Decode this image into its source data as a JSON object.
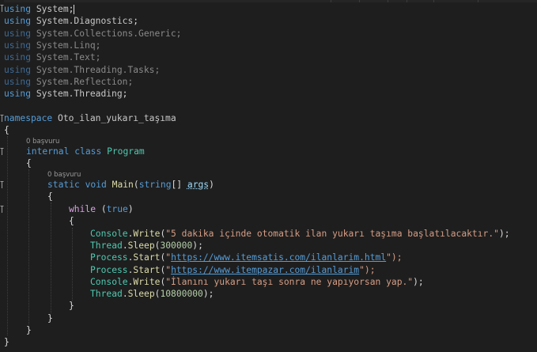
{
  "editor": {
    "usings": [
      {
        "kw": "using",
        "ns": "System",
        "rest": ";"
      },
      {
        "kw": "using",
        "ns": "System.Diagnostics",
        "rest": ";"
      },
      {
        "kw": "using",
        "ns": "System.Collections.Generic",
        "rest": ";"
      },
      {
        "kw": "using",
        "ns": "System.Linq",
        "rest": ";"
      },
      {
        "kw": "using",
        "ns": "System.Text",
        "rest": ";"
      },
      {
        "kw": "using",
        "ns": "System.Threading.Tasks",
        "rest": ";"
      },
      {
        "kw": "using",
        "ns": "System.Reflection",
        "rest": ";"
      },
      {
        "kw": "using",
        "ns": "System.Threading",
        "rest": ";"
      }
    ],
    "namespace_kw": "namespace",
    "namespace_name": "Oto_ilan_yukarı_taşıma",
    "refcount_class": "0 başvuru",
    "refcount_main": "0 başvuru",
    "class_decl": {
      "kw1": "internal",
      "kw2": "class",
      "name": "Program"
    },
    "main_decl": {
      "kw1": "static",
      "kw2": "void",
      "name": "Main",
      "paren_open": "(",
      "kw3": "string",
      "brackets": "[] ",
      "param": "args",
      "paren_close": ")"
    },
    "while_kw": "while",
    "while_cond_open": " (",
    "true_kw": "true",
    "while_cond_close": ")",
    "body": [
      {
        "type": "Console",
        "method": "Write",
        "arg": "\"5 dakika içinde otomatik ilan yukarı taşıma başlatılacaktır.\"",
        "end": ");"
      },
      {
        "type": "Thread",
        "method": "Sleep",
        "arg": "300000",
        "end": ");"
      },
      {
        "type": "Process",
        "method": "Start",
        "arg": "https://www.itemsatis.com/ilanlarim.html",
        "end": "\");"
      },
      {
        "type": "Process",
        "method": "Start",
        "arg": "https://www.itempazar.com/ilanlarim",
        "end": "\");"
      },
      {
        "type": "Console",
        "method": "Write",
        "arg": "\"İlanını yukarı taşı sonra ne yapıyorsan yap.\"",
        "end": ");"
      },
      {
        "type": "Thread",
        "method": "Sleep",
        "arg": "10800000",
        "end": ");"
      }
    ],
    "brace_open": "{",
    "brace_close": "}",
    "dot": ".",
    "paren": "(",
    "quote": "\""
  }
}
